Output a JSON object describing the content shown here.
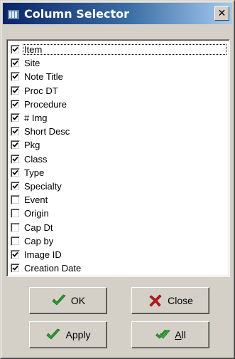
{
  "window": {
    "title": "Column Selector",
    "close_glyph": "✕"
  },
  "columns": [
    {
      "label": "Item",
      "checked": true
    },
    {
      "label": "Site",
      "checked": true
    },
    {
      "label": "Note Title",
      "checked": true
    },
    {
      "label": "Proc DT",
      "checked": true
    },
    {
      "label": "Procedure",
      "checked": true
    },
    {
      "label": "# Img",
      "checked": true
    },
    {
      "label": "Short Desc",
      "checked": true
    },
    {
      "label": "Pkg",
      "checked": true
    },
    {
      "label": "Class",
      "checked": true
    },
    {
      "label": "Type",
      "checked": true
    },
    {
      "label": "Specialty",
      "checked": true
    },
    {
      "label": "Event",
      "checked": false
    },
    {
      "label": "Origin",
      "checked": false
    },
    {
      "label": "Cap Dt",
      "checked": false
    },
    {
      "label": "Cap by",
      "checked": false
    },
    {
      "label": "Image ID",
      "checked": true
    },
    {
      "label": "Creation Date",
      "checked": true
    }
  ],
  "buttons": {
    "ok": {
      "label": "OK",
      "icon": "green-check-icon"
    },
    "close": {
      "label": "Close",
      "icon": "red-x-icon"
    },
    "apply": {
      "label": "Apply",
      "icon": "green-check-icon"
    },
    "all": {
      "label_underlined": "A",
      "label_rest": "ll",
      "icon": "double-check-icon"
    }
  },
  "colors": {
    "titlebar_start": "#0a246a",
    "titlebar_end": "#a6caf0",
    "face": "#d4d0c8",
    "check_green": "#2e9b2e",
    "x_red": "#c81818"
  }
}
